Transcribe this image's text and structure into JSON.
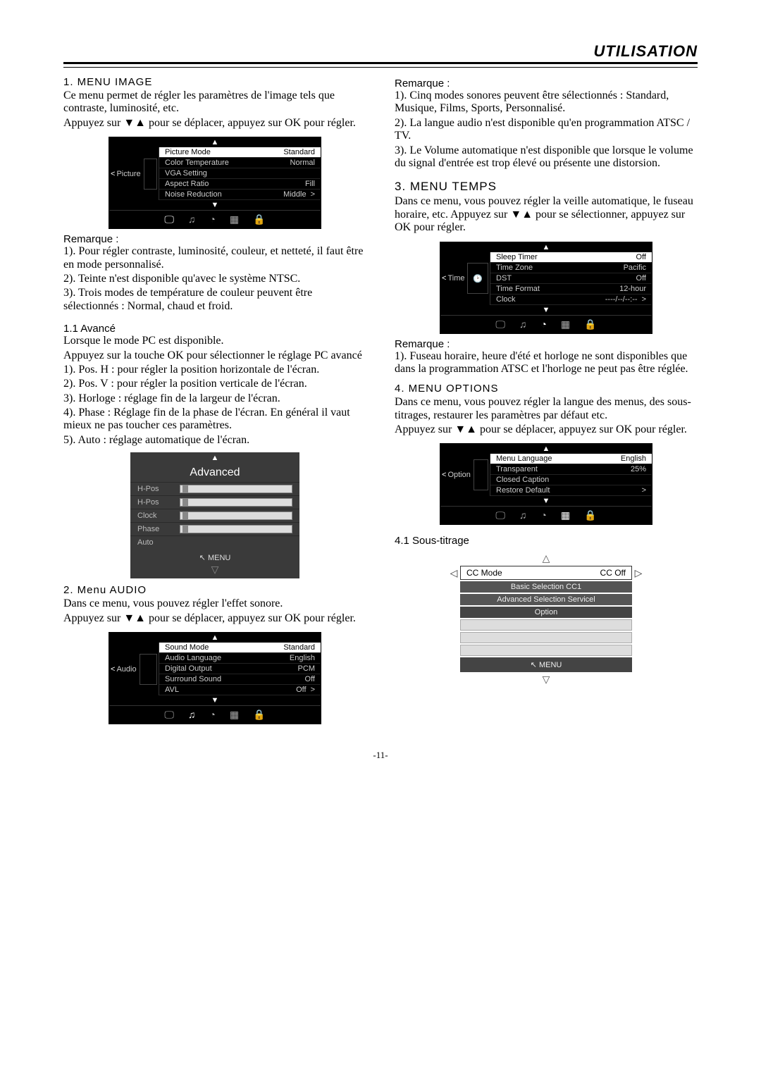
{
  "page": {
    "title": "UTILISATION",
    "number": "-11-"
  },
  "image": {
    "title": "1. MENU IMAGE",
    "p1": "Ce menu permet de régler les paramètres de l'image tels que contraste, luminosité, etc.",
    "p2": "Appuyez sur ▼▲ pour se déplacer, appuyez sur OK pour régler.",
    "remark_title": "Remarque   :",
    "r1": "1). Pour régler contraste, luminosité, couleur, et netteté, il faut être en mode personnalisé.",
    "r2": "2). Teinte n'est disponible qu'avec le système NTSC.",
    "r3": "3). Trois modes de température de couleur peuvent être sélectionnés : Normal, chaud et froid.",
    "menu": {
      "category_label": "Picture",
      "rows": [
        {
          "label": "Picture Mode",
          "value": "Standard",
          "hl": true
        },
        {
          "label": "Color Temperature",
          "value": "Normal"
        },
        {
          "label": "VGA Setting",
          "value": ""
        },
        {
          "label": "Aspect Ratio",
          "value": "Fill"
        },
        {
          "label": "Noise Reduction",
          "value": "Middle",
          "chev": true
        }
      ]
    }
  },
  "advanced": {
    "title": "1.1 Avancé",
    "p1": "Lorsque le mode PC est disponible.",
    "p2": "Appuyez sur la touche OK pour sélectionner le réglage PC avancé",
    "l1": "1). Pos. H : pour régler la position horizontale de l'écran.",
    "l2": "2). Pos. V : pour régler la position verticale de l'écran.",
    "l3": "3). Horloge : réglage fin de la largeur de l'écran.",
    "l4": "4). Phase : Réglage fin de la phase de l'écran. En général il vaut mieux ne pas toucher ces paramètres.",
    "l5": "5). Auto : réglage automatique de l'écran.",
    "menu": {
      "title": "Advanced",
      "rows": [
        "H-Pos",
        "H-Pos",
        "Clock",
        "Phase",
        "Auto"
      ],
      "menu_label": "MENU"
    }
  },
  "audio": {
    "title": "2.  Menu AUDIO",
    "p1": "Dans ce menu, vous pouvez régler l'effet sonore.",
    "p2": "Appuyez sur ▼▲ pour se déplacer, appuyez sur OK pour régler.",
    "remark_title": "Remarque   :",
    "r1": "1). Cinq modes sonores peuvent être sélectionnés : Standard, Musique, Films, Sports, Personnalisé.",
    "r2": "2). La langue audio n'est disponible qu'en programmation ATSC / TV.",
    "r3": "3). Le Volume automatique n'est disponible que lorsque le volume du signal d'entrée est trop élevé ou présente une distorsion.",
    "menu": {
      "category_label": "Audio",
      "rows": [
        {
          "label": "Sound Mode",
          "value": "Standard",
          "hl": true
        },
        {
          "label": "Audio Language",
          "value": "English"
        },
        {
          "label": "Digital Output",
          "value": "PCM"
        },
        {
          "label": "Surround Sound",
          "value": "Off"
        },
        {
          "label": "AVL",
          "value": "Off",
          "chev": true
        }
      ]
    }
  },
  "time": {
    "title": "3.  MENU TEMPS",
    "p1": "Dans ce menu, vous pouvez régler la veille automatique, le fuseau horaire, etc. Appuyez sur ▼▲ pour se sélectionner, appuyez sur OK pour régler.",
    "remark_title": "Remarque   :",
    "r1": "1). Fuseau horaire, heure d'été et horloge ne sont disponibles que dans la programmation ATSC et l'horloge ne peut pas être réglée.",
    "menu": {
      "category_label": "Time",
      "rows": [
        {
          "label": "Sleep Timer",
          "value": "Off",
          "hl": true
        },
        {
          "label": "Time Zone",
          "value": "Pacific"
        },
        {
          "label": "DST",
          "value": "Off"
        },
        {
          "label": "Time Format",
          "value": "12-hour"
        },
        {
          "label": "Clock",
          "value": "----/--/--:--",
          "chev": true
        }
      ]
    }
  },
  "options": {
    "title": "4.  MENU OPTIONS",
    "p1": "Dans ce menu, vous pouvez régler la langue des menus, des sous-titrages, restaurer les paramètres par défaut etc.",
    "p2": "Appuyez sur   ▼▲   pour se déplacer, appuyez sur OK pour régler.",
    "menu": {
      "category_label": "Option",
      "rows": [
        {
          "label": "Menu Language",
          "value": "English",
          "hl": true
        },
        {
          "label": "Transparent",
          "value": "25%"
        },
        {
          "label": "Closed Caption",
          "value": ""
        },
        {
          "label": "Restore Default",
          "value": "",
          "chev": true
        }
      ]
    }
  },
  "cc": {
    "title": "4.1 Sous-titrage",
    "hdr_label": "CC Mode",
    "hdr_value": "CC Off",
    "rows": [
      "Basic Selection CC1",
      "Advanced Selection Servicel",
      "Option"
    ],
    "menu_label": "MENU"
  },
  "icons": {
    "tv": "🖵",
    "music": "♫",
    "clock": "◔",
    "grid": "▦",
    "lock": "🔒"
  }
}
